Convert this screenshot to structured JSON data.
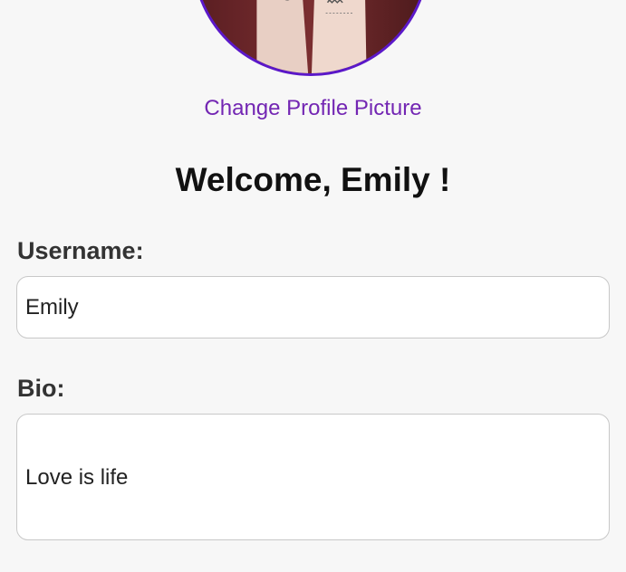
{
  "profile": {
    "change_picture_label": "Change Profile Picture",
    "welcome_text": "Welcome, Emily !"
  },
  "form": {
    "username_label": "Username:",
    "username_value": "Emily",
    "bio_label": "Bio:",
    "bio_value": "Love is life"
  },
  "colors": {
    "accent": "#7326b3",
    "avatar_border": "#5b18c9",
    "background": "#f7f7f7"
  }
}
